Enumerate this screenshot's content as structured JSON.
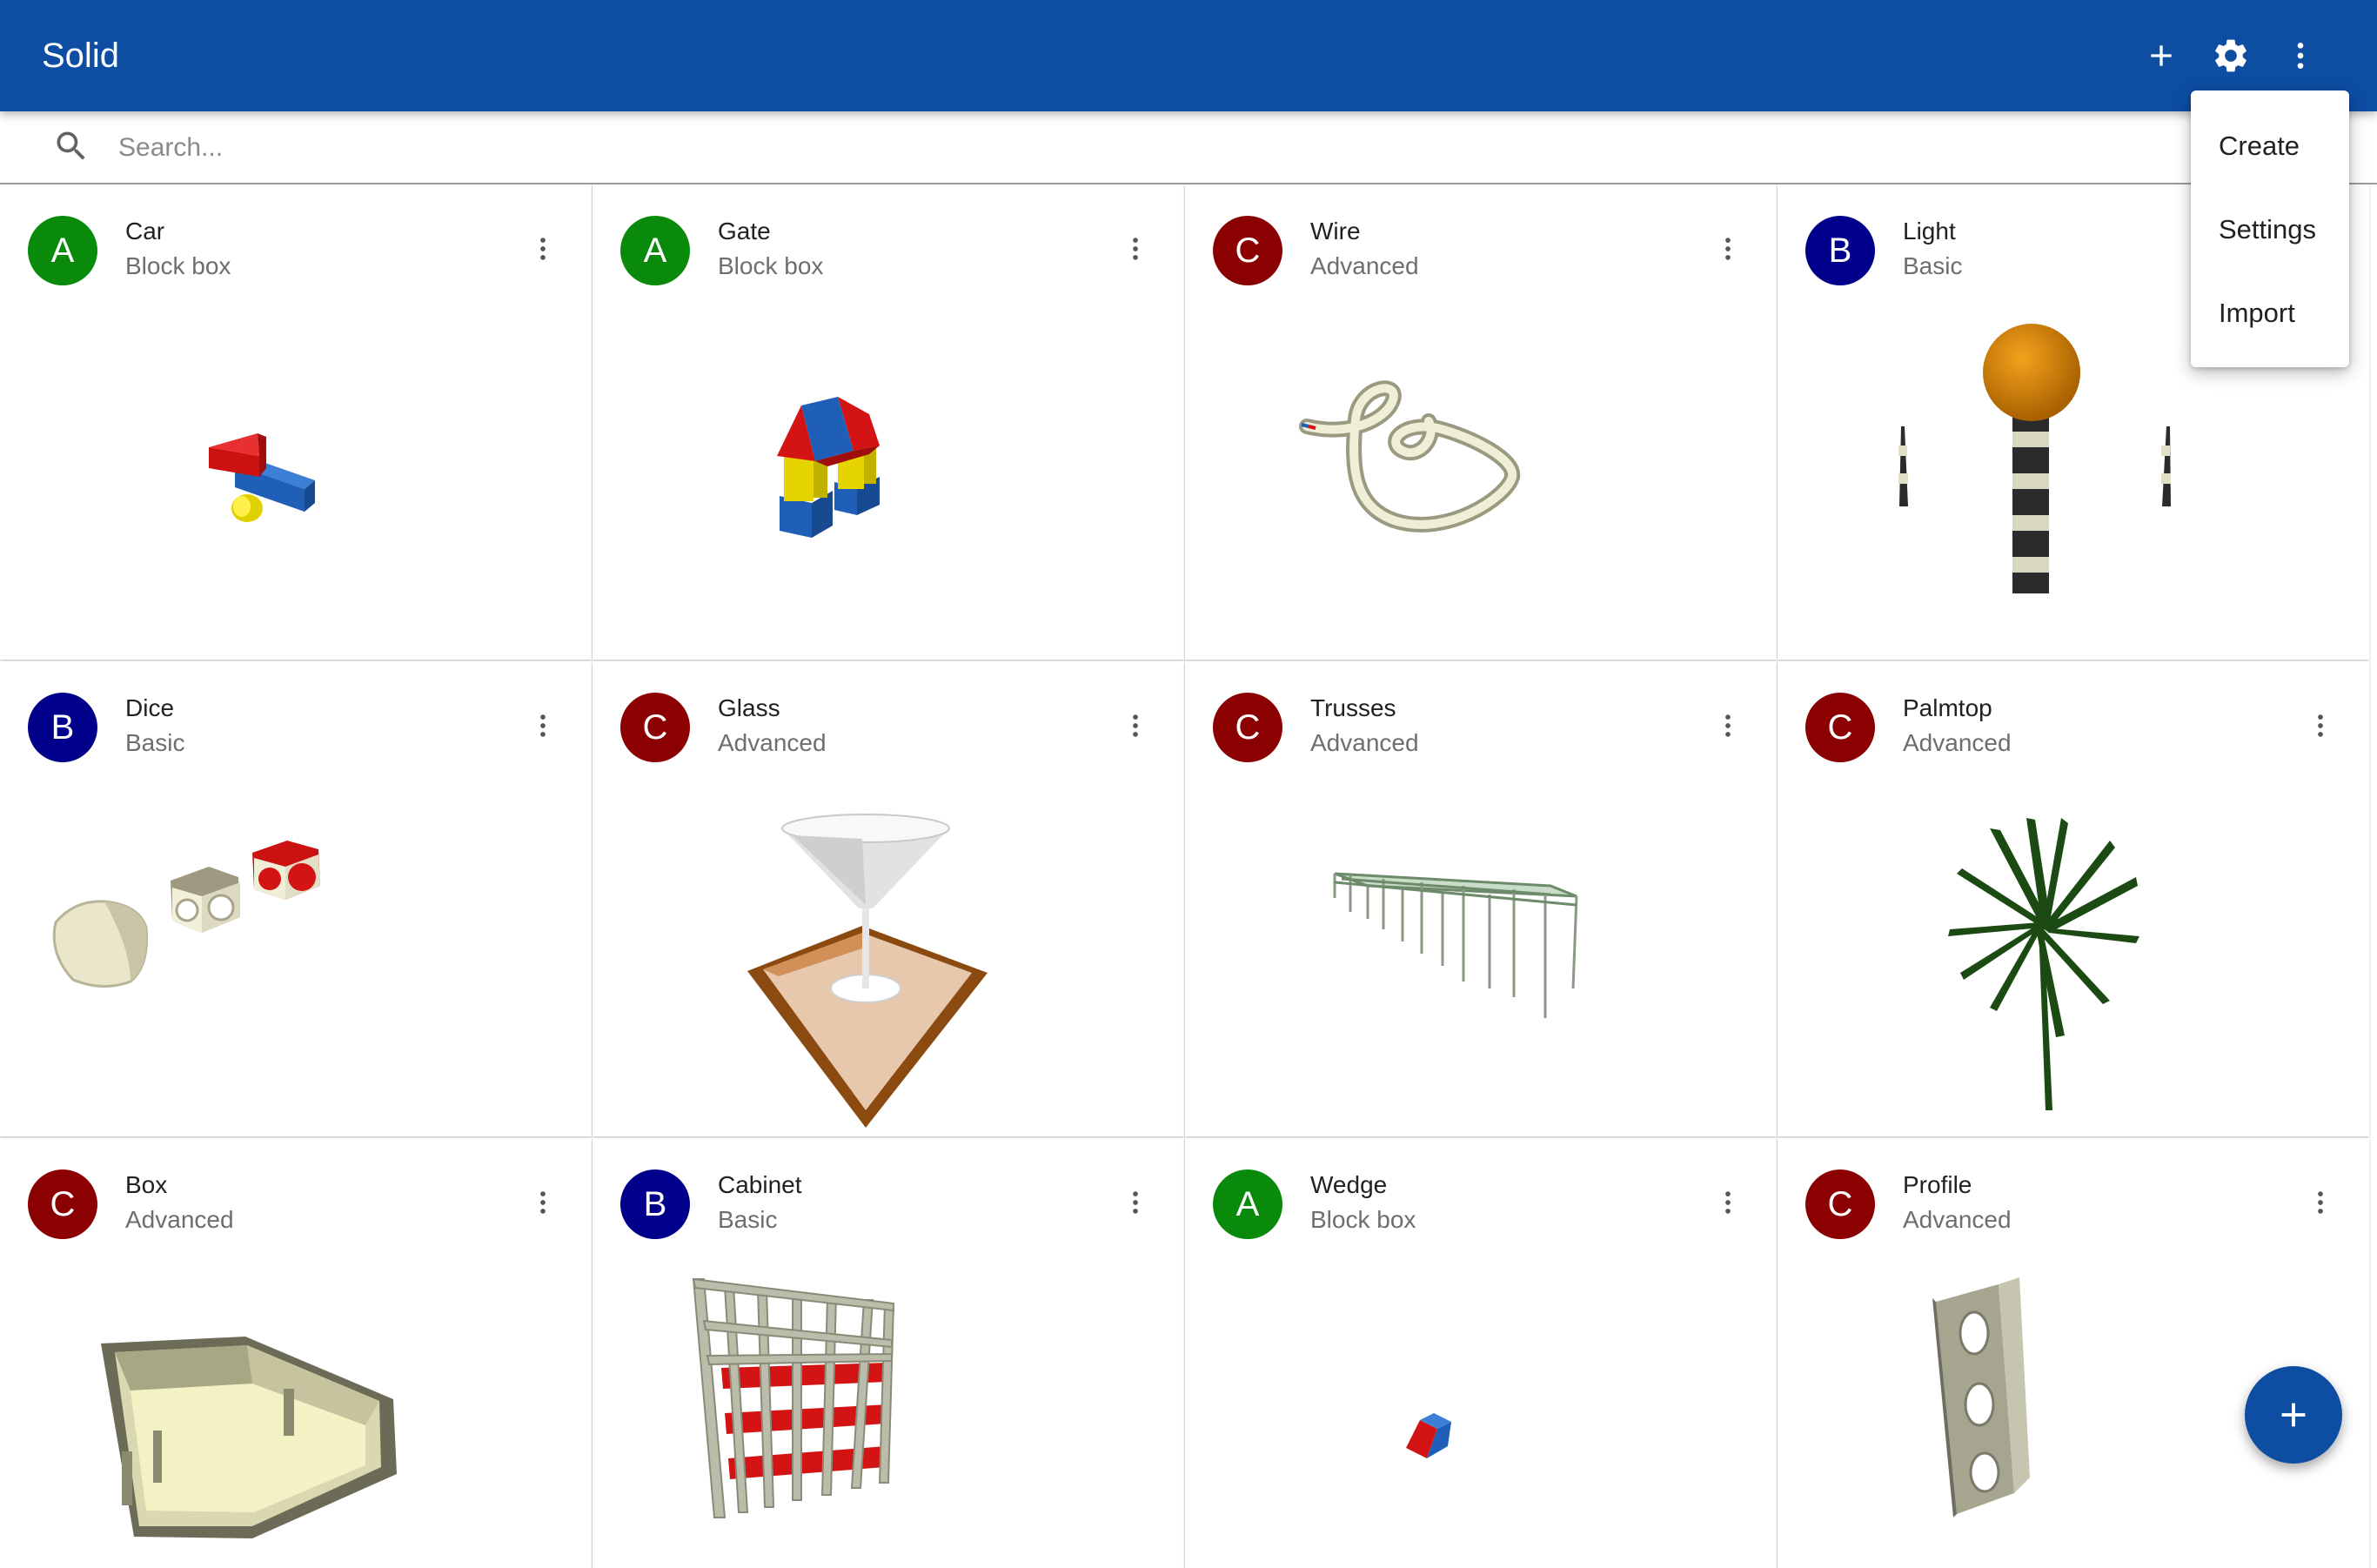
{
  "app": {
    "title": "Solid"
  },
  "toolbar": {
    "add_icon": "add-icon",
    "settings_icon": "gear-icon",
    "more_icon": "more-vert-icon"
  },
  "search": {
    "placeholder": "Search...",
    "value": "",
    "icon": "search-icon"
  },
  "menu": {
    "items": [
      {
        "label": "Create"
      },
      {
        "label": "Settings"
      },
      {
        "label": "Import"
      }
    ]
  },
  "colors": {
    "appbar": "#0d4ea3",
    "level_a": "#0a8a0a",
    "level_b": "#00008b",
    "level_c": "#8b0000"
  },
  "cards": [
    {
      "letter": "A",
      "name": "Car",
      "category": "Block box"
    },
    {
      "letter": "A",
      "name": "Gate",
      "category": "Block box"
    },
    {
      "letter": "C",
      "name": "Wire",
      "category": "Advanced"
    },
    {
      "letter": "B",
      "name": "Light",
      "category": "Basic"
    },
    {
      "letter": "B",
      "name": "Dice",
      "category": "Basic"
    },
    {
      "letter": "C",
      "name": "Glass",
      "category": "Advanced"
    },
    {
      "letter": "C",
      "name": "Trusses",
      "category": "Advanced"
    },
    {
      "letter": "C",
      "name": "Palmtop",
      "category": "Advanced"
    },
    {
      "letter": "C",
      "name": "Box",
      "category": "Advanced"
    },
    {
      "letter": "B",
      "name": "Cabinet",
      "category": "Basic"
    },
    {
      "letter": "A",
      "name": "Wedge",
      "category": "Block box"
    },
    {
      "letter": "C",
      "name": "Profile",
      "category": "Advanced"
    }
  ],
  "fab": {
    "icon": "add-icon"
  }
}
